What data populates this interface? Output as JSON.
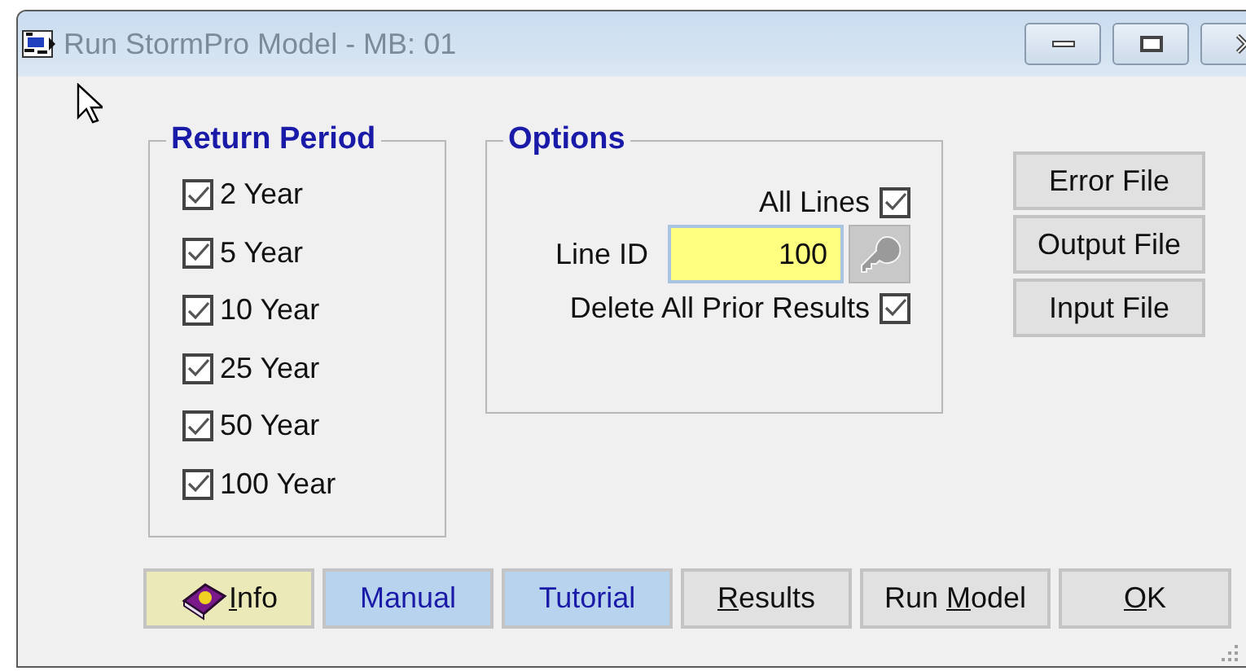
{
  "window": {
    "title": "Run StormPro Model - MB: 01"
  },
  "return_period": {
    "title": "Return Period",
    "items": [
      {
        "label": "2 Year",
        "checked": true
      },
      {
        "label": "5 Year",
        "checked": true
      },
      {
        "label": "10 Year",
        "checked": true
      },
      {
        "label": "25 Year",
        "checked": true
      },
      {
        "label": "50 Year",
        "checked": true
      },
      {
        "label": "100 Year",
        "checked": true
      }
    ]
  },
  "options": {
    "title": "Options",
    "all_lines": {
      "label": "All Lines",
      "checked": true
    },
    "line_id": {
      "label": "Line ID",
      "value": "100"
    },
    "delete_prior": {
      "label": "Delete All Prior Results",
      "checked": true
    }
  },
  "file_buttons": [
    "Error File",
    "Output File",
    "Input File"
  ],
  "buttons": [
    {
      "kind": "info",
      "access_key": "I",
      "after": "nfo"
    },
    {
      "kind": "link",
      "before": "Manual"
    },
    {
      "kind": "link",
      "before": "Tutorial"
    },
    {
      "kind": "plain",
      "access_key": "R",
      "after": "esults"
    },
    {
      "kind": "plain",
      "before": "Run ",
      "access_key": "M",
      "after": "odel"
    },
    {
      "kind": "plain",
      "access_key": "O",
      "after": "K"
    }
  ]
}
